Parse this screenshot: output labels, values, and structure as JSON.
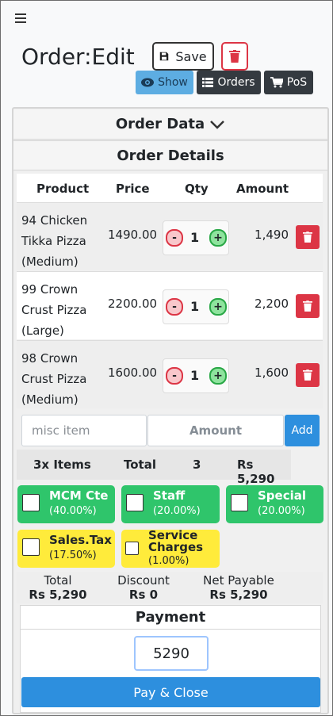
{
  "page": {
    "title": "Order:Edit",
    "save_label": "Save",
    "show_label": "Show",
    "orders_label": "Orders",
    "pos_label": "PoS"
  },
  "sections": {
    "order_data": "Order Data",
    "order_details": "Order Details",
    "payment": "Payment"
  },
  "table": {
    "headers": [
      "Product",
      "Price",
      "Qty",
      "Amount"
    ],
    "rows": [
      {
        "product": "94 Chicken Tikka Pizza (Medium)",
        "price": "1490.00",
        "minus": "-",
        "qty": "1",
        "plus": "+",
        "amount": "1,490"
      },
      {
        "product": "99 Crown Crust Pizza (Large)",
        "price": "2200.00",
        "minus": "-",
        "qty": "1",
        "plus": "+",
        "amount": "2,200"
      },
      {
        "product": "98 Crown Crust Pizza (Medium)",
        "price": "1600.00",
        "minus": "-",
        "qty": "1",
        "plus": "+",
        "amount": "1,600"
      }
    ]
  },
  "misc": {
    "item_placeholder": "misc item",
    "amount_placeholder": "Amount",
    "add_label": "Add"
  },
  "summary": {
    "items": "3x Items",
    "total_label": "Total",
    "total_qty": "3",
    "total_amount": "Rs 5,290"
  },
  "charges": [
    {
      "name": "MCM Cte",
      "value": "(40.00%)",
      "color": "#2fc56b"
    },
    {
      "name": "Staff",
      "value": "(20.00%)",
      "color": "#2fc56b"
    },
    {
      "name": "Special",
      "value": "(20.00%)",
      "color": "#2fc56b"
    },
    {
      "name": "Sales.Tax",
      "value": "(17.50%)",
      "color": "#ffeb3b"
    },
    {
      "name": "Service Charges",
      "value": "(1.00%)",
      "color": "#ffeb3b"
    }
  ],
  "totals": {
    "total_label": "Total",
    "total_value": "Rs 5,290",
    "discount_label": "Discount",
    "discount_value": "Rs 0",
    "net_label": "Net Payable",
    "net_value": "Rs 5,290"
  },
  "payment": {
    "amount": "5290",
    "pay_label": "Pay & Close"
  },
  "colors": {
    "danger": "#dc3545",
    "primary": "#2d8fde",
    "info": "#5dade2",
    "dark": "#343a40",
    "success": "#2fc56b",
    "warning": "#ffeb3b"
  }
}
